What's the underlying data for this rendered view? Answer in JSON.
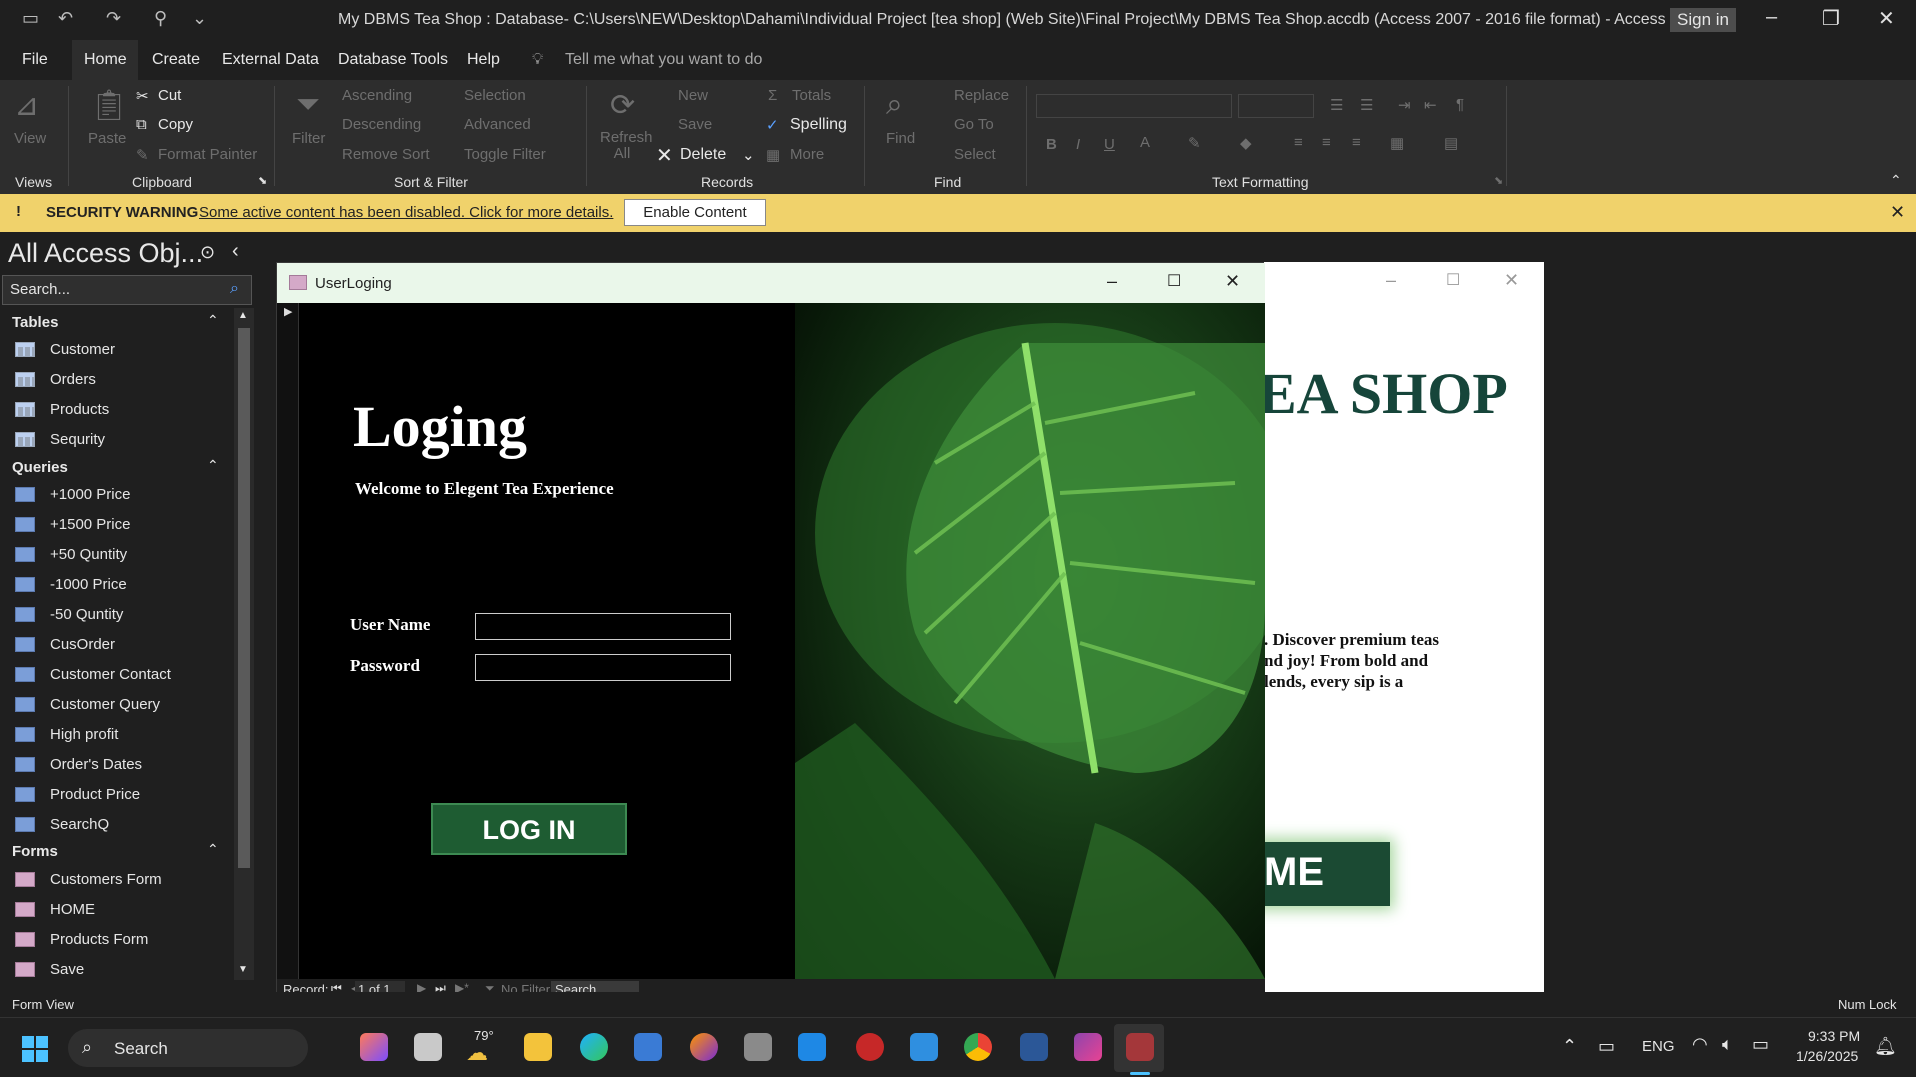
{
  "titlebar": {
    "title": "My DBMS Tea Shop : Database- C:\\Users\\NEW\\Desktop\\Dahami\\Individual Project [tea shop] (Web Site)\\Final Project\\My DBMS Tea Shop.accdb (Access 2007 - 2016 file format)  -  Access",
    "sign_in": "Sign in"
  },
  "menu": {
    "file": "File",
    "home": "Home",
    "create": "Create",
    "external_data": "External Data",
    "database_tools": "Database Tools",
    "help": "Help",
    "tell_me": "Tell me what you want to do"
  },
  "ribbon": {
    "views": {
      "view": "View",
      "group": "Views"
    },
    "clipboard": {
      "paste": "Paste",
      "cut": "Cut",
      "copy": "Copy",
      "format_painter": "Format Painter",
      "group": "Clipboard"
    },
    "sort_filter": {
      "filter": "Filter",
      "ascending": "Ascending",
      "descending": "Descending",
      "remove_sort": "Remove Sort",
      "selection": "Selection",
      "advanced": "Advanced",
      "toggle_filter": "Toggle Filter",
      "group": "Sort & Filter"
    },
    "records": {
      "refresh_all": "Refresh All",
      "new": "New",
      "save": "Save",
      "delete": "Delete",
      "totals": "Totals",
      "spelling": "Spelling",
      "more": "More",
      "group": "Records"
    },
    "find": {
      "find": "Find",
      "replace": "Replace",
      "go_to": "Go To",
      "select": "Select",
      "group": "Find"
    },
    "text_formatting": {
      "group": "Text Formatting"
    }
  },
  "security": {
    "label": "SECURITY WARNING",
    "message": "Some active content has been disabled. Click for more details.",
    "button": "Enable Content"
  },
  "nav": {
    "title": "All Access Obj...",
    "search_placeholder": "Search...",
    "tables_header": "Tables",
    "tables": [
      "Customer",
      "Orders",
      "Products",
      "Sequrity"
    ],
    "queries_header": "Queries",
    "queries": [
      "+1000 Price",
      "+1500 Price",
      "+50 Quntity",
      "-1000 Price",
      "-50 Quntity",
      "CusOrder",
      "Customer Contact",
      "Customer Query",
      "High profit",
      "Order's Dates",
      "Product Price",
      "SearchQ"
    ],
    "forms_header": "Forms",
    "forms": [
      "Customers Form",
      "HOME",
      "Products Form",
      "Save"
    ]
  },
  "login_form": {
    "window_title": "UserLoging",
    "heading": "Loging",
    "subheading": "Welcome to Elegent Tea Experience",
    "username_label": "User Name",
    "password_label": "Password",
    "login_button": "LOG IN",
    "record_label": "Record:",
    "record_position": "1 of 1",
    "no_filter": "No Filter",
    "search": "Search"
  },
  "home_form": {
    "heading_partial": "EA SHOP",
    "text_line1": ". Discover premium teas",
    "text_line2": "nd joy! From bold and",
    "text_line3": "lends, every sip is a",
    "button_partial": "ME"
  },
  "statusbar": {
    "left": "Form View",
    "right": "Num Lock"
  },
  "taskbar": {
    "search": "Search",
    "weather": "79°",
    "language": "ENG",
    "time": "9:33 PM",
    "date": "1/26/2025"
  }
}
